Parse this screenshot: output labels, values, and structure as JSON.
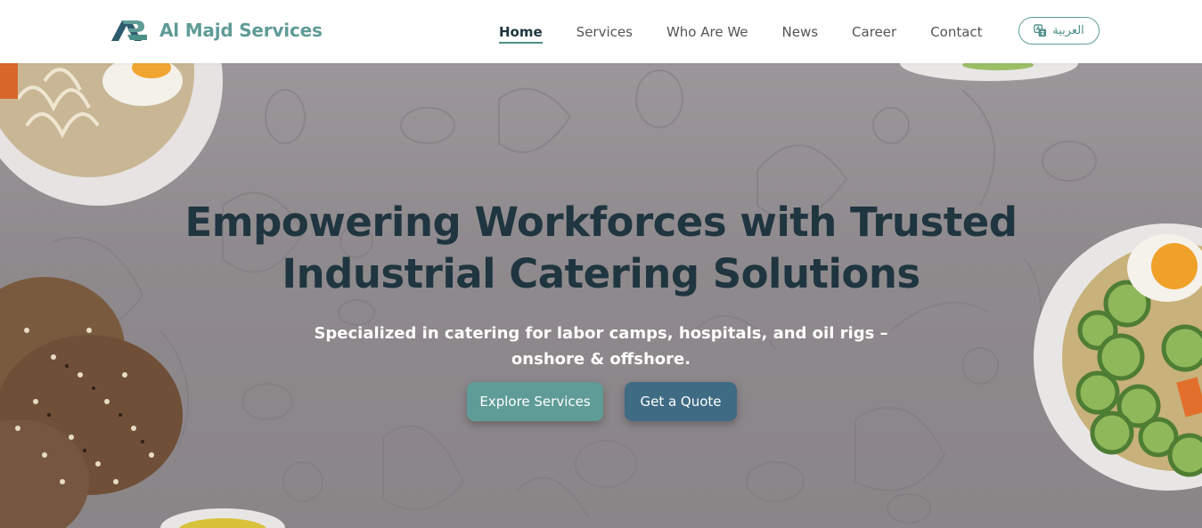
{
  "brand": {
    "name": "Al Majd Services",
    "logo_icon": "al-majd-logo-icon"
  },
  "nav": {
    "items": [
      {
        "label": "Home",
        "active": true
      },
      {
        "label": "Services",
        "active": false
      },
      {
        "label": "Who Are We",
        "active": false
      },
      {
        "label": "News",
        "active": false
      },
      {
        "label": "Career",
        "active": false
      },
      {
        "label": "Contact",
        "active": false
      }
    ],
    "language_button": {
      "label": "العربية",
      "icon": "translate-icon"
    }
  },
  "hero": {
    "title_line1": "Empowering Workforces with Trusted",
    "title_line2": "Industrial Catering Solutions",
    "subtitle_line1": "Specialized in catering for labor camps, hospitals, and oil rigs –",
    "subtitle_line2": "onshore & offshore.",
    "primary_button": "Explore Services",
    "secondary_button": "Get a Quote"
  },
  "colors": {
    "brand": "#5f9c97",
    "title": "#1f3540",
    "primary_button": "#5f9c97",
    "secondary_button": "#3f6b84"
  }
}
